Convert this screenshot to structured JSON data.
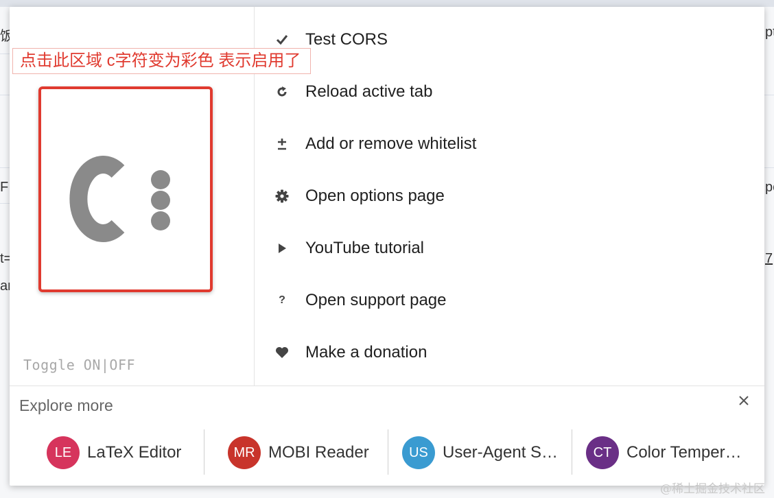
{
  "annotation": {
    "text": "点击此区域 c字符变为彩色 表示启用了"
  },
  "toggle": {
    "label": "Toggle ON|OFF"
  },
  "menu": {
    "items": [
      {
        "label": "Test CORS",
        "icon": "check-icon"
      },
      {
        "label": "Reload active tab",
        "icon": "reload-icon"
      },
      {
        "label": "Add or remove whitelist",
        "icon": "plus-minus-icon"
      },
      {
        "label": "Open options page",
        "icon": "gear-icon"
      },
      {
        "label": "YouTube tutorial",
        "icon": "play-icon"
      },
      {
        "label": "Open support page",
        "icon": "question-icon"
      },
      {
        "label": "Make a donation",
        "icon": "heart-icon"
      }
    ]
  },
  "explore": {
    "title": "Explore more",
    "extensions": [
      {
        "initials": "LE",
        "name": "LaTeX Editor",
        "color": "#d6345c"
      },
      {
        "initials": "MR",
        "name": "MOBI Reader",
        "color": "#c8342b"
      },
      {
        "initials": "US",
        "name": "User-Agent S…",
        "color": "#3a9bd1"
      },
      {
        "initials": "CT",
        "name": "Color Temper…",
        "color": "#6a2f86"
      }
    ]
  },
  "watermark": {
    "text": "@稀土掘金技术社区"
  },
  "background": {
    "fragments": [
      "饭",
      "F",
      "t=",
      "ar",
      "pt",
      "pc",
      "7"
    ]
  },
  "colors": {
    "annotation": "#e03a2f",
    "icon_gray": "#8a8a8a",
    "toggle_text": "#a8a8a8"
  }
}
